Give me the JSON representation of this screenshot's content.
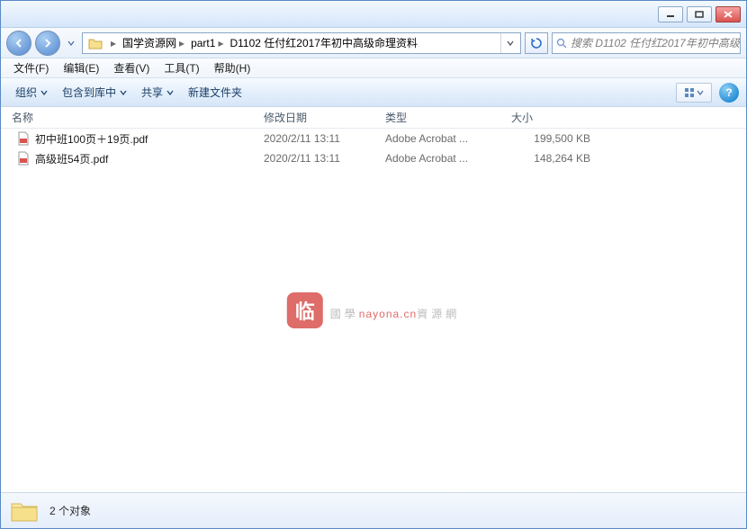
{
  "titlebar": {
    "minimize": "min",
    "maximize": "max",
    "close": "close"
  },
  "nav": {
    "breadcrumb": [
      "国学资源网",
      "part1",
      "D1102 任付红2017年初中高级命理资料"
    ],
    "search_placeholder": "搜索 D1102 任付红2017年初中高级..."
  },
  "menubar": [
    "文件(F)",
    "编辑(E)",
    "查看(V)",
    "工具(T)",
    "帮助(H)"
  ],
  "toolbar": {
    "organize": "组织",
    "include": "包含到库中",
    "share": "共享",
    "new_folder": "新建文件夹"
  },
  "columns": {
    "name": "名称",
    "date": "修改日期",
    "type": "类型",
    "size": "大小"
  },
  "files": [
    {
      "name": "初中班100页＋19页.pdf",
      "date": "2020/2/11 13:11",
      "type": "Adobe Acrobat ...",
      "size": "199,500 KB"
    },
    {
      "name": "高级班54页.pdf",
      "date": "2020/2/11 13:11",
      "type": "Adobe Acrobat ...",
      "size": "148,264 KB"
    }
  ],
  "watermark": {
    "logo": "临",
    "text_a": "國學",
    "domain": "nayona.cn",
    "text_b": "資源網"
  },
  "statusbar": {
    "count_text": "2 个对象"
  }
}
